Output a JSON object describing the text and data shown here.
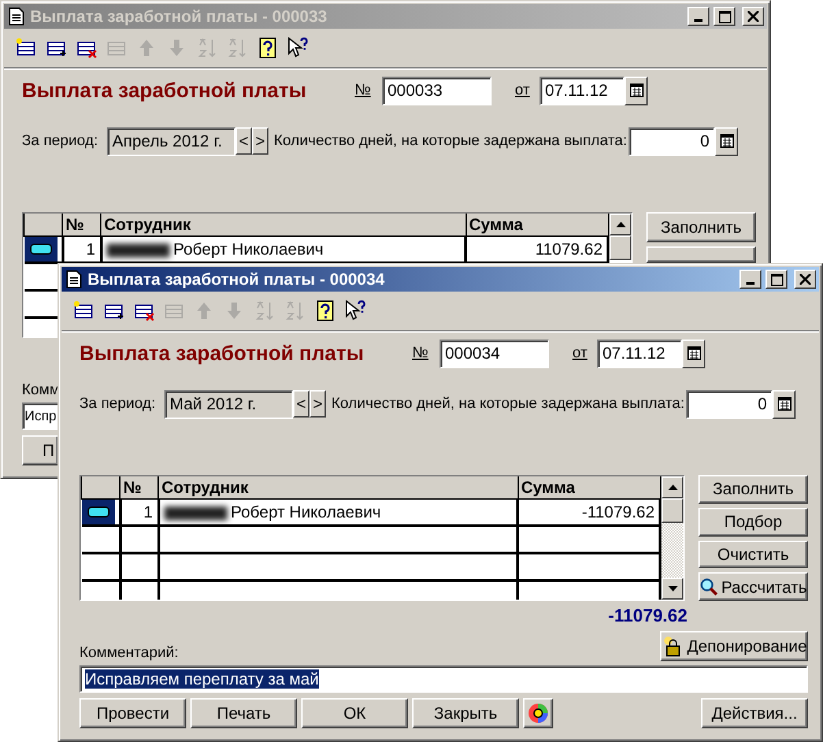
{
  "windows": [
    {
      "title": "Выплата заработной платы - 000033",
      "active": false,
      "toolbar": [
        {
          "disabled": false
        },
        {
          "disabled": false
        },
        {
          "disabled": false
        },
        {
          "disabled": true
        },
        {
          "disabled": true
        },
        {
          "disabled": true
        },
        {
          "disabled": true
        },
        {
          "disabled": true
        },
        {
          "disabled": false
        },
        {
          "disabled": false
        }
      ],
      "heading": "Выплата заработной платы",
      "number_label": "№",
      "number": "000033",
      "date_label": "от",
      "date": "07.11.12",
      "period_label": "За период:",
      "period": "Апрель 2012 г.",
      "prev": "<",
      "next": ">",
      "delay_label": "Количество дней, на которые задержана выплата:",
      "delay": "0",
      "table": {
        "columns": [
          "№",
          "Сотрудник",
          "Сумма"
        ],
        "rows": [
          {
            "current": true,
            "number": "1",
            "employee": "Роберт Николаевич",
            "amount": "11079.62"
          }
        ]
      },
      "side_buttons": [
        {
          "kind": "text",
          "label": "Заполнить"
        },
        {
          "kind": "text"
        }
      ],
      "comment_label": "Комм",
      "comment": "Испр",
      "comment_selected": false,
      "buttons": [
        {
          "kind": "text",
          "label": "П"
        }
      ]
    },
    {
      "title": "Выплата заработной платы - 000034",
      "active": true,
      "toolbar": [
        {
          "disabled": false
        },
        {
          "disabled": false
        },
        {
          "disabled": false
        },
        {
          "disabled": true
        },
        {
          "disabled": true
        },
        {
          "disabled": true
        },
        {
          "disabled": true
        },
        {
          "disabled": true
        },
        {
          "disabled": false
        },
        {
          "disabled": false
        }
      ],
      "heading": "Выплата заработной платы",
      "number_label": "№",
      "number": "000034",
      "date_label": "от",
      "date": "07.11.12",
      "period_label": "За период:",
      "period": "Май 2012 г.",
      "prev": "<",
      "next": ">",
      "delay_label": "Количество дней, на которые задержана выплата:",
      "delay": "0",
      "table": {
        "columns": [
          "№",
          "Сотрудник",
          "Сумма"
        ],
        "rows": [
          {
            "current": true,
            "number": "1",
            "employee": "Роберт Николаевич",
            "amount": "-11079.62"
          }
        ]
      },
      "side_buttons": [
        {
          "kind": "text",
          "label": "Заполнить"
        },
        {
          "kind": "text",
          "label": "Подбор"
        },
        {
          "kind": "text",
          "label": "Очистить"
        },
        {
          "kind": "search",
          "label": "Рассчитать"
        }
      ],
      "total": "-11079.62",
      "deposit_button": "Депонирование",
      "comment_label": "Комментарий:",
      "comment": "Исправляем переплату за май",
      "comment_selected": true,
      "buttons": [
        {
          "kind": "text",
          "label": "Провести"
        },
        {
          "kind": "text",
          "label": "Печать"
        },
        {
          "kind": "text",
          "label": "ОК"
        },
        {
          "kind": "text",
          "label": "Закрыть"
        },
        {
          "kind": "icon"
        },
        {
          "kind": "menu",
          "label": "Действия..."
        }
      ]
    }
  ]
}
